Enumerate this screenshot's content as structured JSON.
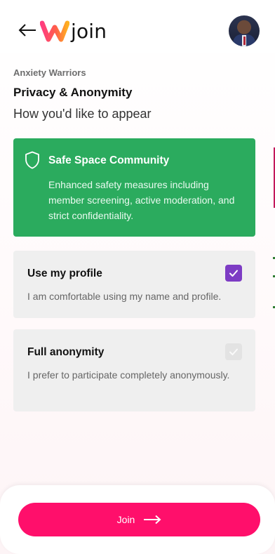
{
  "header": {
    "logo_text": "join",
    "back_icon": "arrow-left-icon",
    "avatar_icon": "user-avatar"
  },
  "group": {
    "name": "Anxiety Warriors"
  },
  "section": {
    "title": "Privacy & Anonymity",
    "subtitle": "How you'd like to appear"
  },
  "safe_space": {
    "icon": "shield-icon",
    "title": "Safe Space Community",
    "description": "Enhanced safety measures including member screening, active moderation, and strict confidentiality.",
    "color": "#2bab5e"
  },
  "options": [
    {
      "title": "Use my profile",
      "description": "I am comfortable using my name and profile.",
      "checked": true
    },
    {
      "title": "Full anonymity",
      "description": "I prefer to participate completely anonymously.",
      "checked": false
    }
  ],
  "footer": {
    "join_label": "Join",
    "join_icon": "arrow-right-icon",
    "button_color": "#ff0f6b"
  },
  "colors": {
    "check_accent": "#7d3cc4",
    "logo_gradient": [
      "#ff3d7f",
      "#ffb020"
    ]
  }
}
